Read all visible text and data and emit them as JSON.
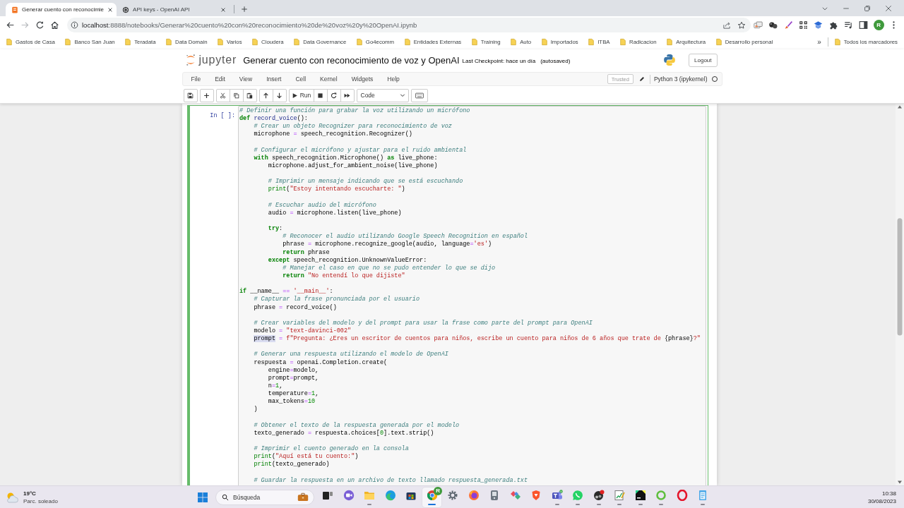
{
  "browser": {
    "tabs": [
      {
        "title": "Generar cuento con reconocimie",
        "selected": true
      },
      {
        "title": "API keys - OpenAI API",
        "selected": false
      }
    ],
    "nav_buttons": [
      {
        "kind": "back",
        "disabled": false
      },
      {
        "kind": "forward",
        "disabled": true
      },
      {
        "kind": "reload",
        "disabled": false
      },
      {
        "kind": "home",
        "disabled": false
      }
    ],
    "address": {
      "host": "localhost",
      "path": ":8888/notebooks/Generar%20cuento%20con%20reconocimiento%20de%20voz%20y%20OpenAI.ipynb"
    },
    "profile_initial": "R",
    "bookmarks": [
      "Gastos de Casa",
      "Banco San Juan",
      "Teradata",
      "Data Domain",
      "Varios",
      "Cloudera",
      "Data Governance",
      "Go4ecomm",
      "Entidades Externas",
      "Training",
      "Auto",
      "Importados",
      "ITBA",
      "Radicacion",
      "Arquitectura",
      "Desarrollo personal"
    ],
    "bookmarks_more": "»",
    "all_bookmarks": "Todos los marcadores"
  },
  "notebook": {
    "logo": "jupyter",
    "title": "Generar cuento con reconocimiento de voz y OpenAI",
    "checkpoint": "Last Checkpoint: hace un día",
    "autosave": "(autosaved)",
    "logout": "Logout",
    "menu": [
      "File",
      "Edit",
      "View",
      "Insert",
      "Cell",
      "Kernel",
      "Widgets",
      "Help"
    ],
    "trusted": "Trusted",
    "kernel": {
      "name": "Python 3 (ipykernel)",
      "busy": false
    },
    "run_label": "Run",
    "cell_type": "Code",
    "cell": {
      "prompt": "In [ ]:",
      "selected": true,
      "code": [
        {
          "kind": "code",
          "tokens": [
            {
              "kind": "comment",
              "text": "# Definir una función para grabar la voz utilizando un micrófono"
            }
          ]
        },
        {
          "kind": "code",
          "tokens": [
            {
              "kind": "keyword",
              "text": "def"
            },
            {
              "kind": "defname",
              "text": " record_voice"
            },
            {
              "kind": "plain",
              "text": "():"
            }
          ],
          "children": [
            {
              "kind": "code",
              "tokens": [
                {
                  "kind": "comment",
                  "text": "# Crear un objeto Recognizer para reconocimiento de voz"
                }
              ]
            },
            {
              "kind": "code",
              "tokens": [
                {
                  "kind": "plain",
                  "text": "microphone "
                },
                {
                  "kind": "operator",
                  "text": "="
                },
                {
                  "kind": "plain",
                  "text": " speech_recognition.Recognizer()"
                }
              ]
            },
            {
              "kind": "blank"
            },
            {
              "kind": "code",
              "tokens": [
                {
                  "kind": "comment",
                  "text": "# Configurar el micrófono y ajustar para el ruido ambiental"
                }
              ]
            },
            {
              "kind": "code",
              "tokens": [
                {
                  "kind": "keyword",
                  "text": "with"
                },
                {
                  "kind": "plain",
                  "text": " speech_recognition.Microphone() "
                },
                {
                  "kind": "keyword",
                  "text": "as"
                },
                {
                  "kind": "plain",
                  "text": " live_phone:"
                }
              ],
              "children": [
                {
                  "kind": "code",
                  "tokens": [
                    {
                      "kind": "plain",
                      "text": "microphone.adjust_for_ambient_noise(live_phone)"
                    }
                  ]
                },
                {
                  "kind": "blank"
                },
                {
                  "kind": "code",
                  "tokens": [
                    {
                      "kind": "comment",
                      "text": "# Imprimir un mensaje indicando que se está escuchando"
                    }
                  ]
                },
                {
                  "kind": "code",
                  "tokens": [
                    {
                      "kind": "builtin",
                      "text": "print"
                    },
                    {
                      "kind": "plain",
                      "text": "("
                    },
                    {
                      "kind": "string",
                      "text": "\"Estoy intentando escucharte: \""
                    },
                    {
                      "kind": "plain",
                      "text": ")"
                    }
                  ]
                },
                {
                  "kind": "blank"
                },
                {
                  "kind": "code",
                  "tokens": [
                    {
                      "kind": "comment",
                      "text": "# Escuchar audio del micrófono"
                    }
                  ]
                },
                {
                  "kind": "code",
                  "tokens": [
                    {
                      "kind": "plain",
                      "text": "audio "
                    },
                    {
                      "kind": "operator",
                      "text": "="
                    },
                    {
                      "kind": "plain",
                      "text": " microphone.listen(live_phone)"
                    }
                  ]
                },
                {
                  "kind": "blank"
                },
                {
                  "kind": "code",
                  "tokens": [
                    {
                      "kind": "keyword",
                      "text": "try"
                    },
                    {
                      "kind": "plain",
                      "text": ":"
                    }
                  ],
                  "children": [
                    {
                      "kind": "code",
                      "tokens": [
                        {
                          "kind": "comment",
                          "text": "# Reconocer el audio utilizando Google Speech Recognition en español"
                        }
                      ]
                    },
                    {
                      "kind": "code",
                      "tokens": [
                        {
                          "kind": "plain",
                          "text": "phrase "
                        },
                        {
                          "kind": "operator",
                          "text": "="
                        },
                        {
                          "kind": "plain",
                          "text": " microphone.recognize_google(audio, language"
                        },
                        {
                          "kind": "operator",
                          "text": "="
                        },
                        {
                          "kind": "string",
                          "text": "'es'"
                        },
                        {
                          "kind": "plain",
                          "text": ")"
                        }
                      ]
                    },
                    {
                      "kind": "code",
                      "tokens": [
                        {
                          "kind": "keyword",
                          "text": "return"
                        },
                        {
                          "kind": "plain",
                          "text": " phrase"
                        }
                      ]
                    }
                  ]
                },
                {
                  "kind": "code",
                  "tokens": [
                    {
                      "kind": "keyword",
                      "text": "except"
                    },
                    {
                      "kind": "plain",
                      "text": " speech_recognition.UnknownValueError:"
                    }
                  ],
                  "children": [
                    {
                      "kind": "code",
                      "tokens": [
                        {
                          "kind": "comment",
                          "text": "# Manejar el caso en que no se pudo entender lo que se dijo"
                        }
                      ]
                    },
                    {
                      "kind": "code",
                      "tokens": [
                        {
                          "kind": "keyword",
                          "text": "return"
                        },
                        {
                          "kind": "string",
                          "text": " \"No entendí lo que dijiste\""
                        }
                      ]
                    }
                  ]
                }
              ]
            }
          ]
        },
        {
          "kind": "blank"
        },
        {
          "kind": "code",
          "tokens": [
            {
              "kind": "keyword",
              "text": "if"
            },
            {
              "kind": "plain",
              "text": " __name__ "
            },
            {
              "kind": "operator",
              "text": "=="
            },
            {
              "kind": "string",
              "text": " '__main__'"
            },
            {
              "kind": "plain",
              "text": ":"
            }
          ],
          "children": [
            {
              "kind": "code",
              "tokens": [
                {
                  "kind": "comment",
                  "text": "# Capturar la frase pronunciada por el usuario"
                }
              ]
            },
            {
              "kind": "code",
              "tokens": [
                {
                  "kind": "plain",
                  "text": "phrase "
                },
                {
                  "kind": "operator",
                  "text": "="
                },
                {
                  "kind": "plain",
                  "text": " record_voice()"
                }
              ]
            },
            {
              "kind": "blank"
            },
            {
              "kind": "code",
              "tokens": [
                {
                  "kind": "comment",
                  "text": "# Crear variables del modelo y del prompt para usar la frase como parte del prompt para OpenAI"
                }
              ]
            },
            {
              "kind": "code",
              "tokens": [
                {
                  "kind": "plain",
                  "text": "modelo "
                },
                {
                  "kind": "operator",
                  "text": "="
                },
                {
                  "kind": "string",
                  "text": " \"text-davinci-002\""
                }
              ]
            },
            {
              "kind": "code",
              "tokens": [
                {
                  "kind": "match",
                  "text": "prompt"
                },
                {
                  "kind": "operator",
                  "text": " ="
                },
                {
                  "kind": "string",
                  "text": " f\"Pregunta: ¿Eres un escritor de cuentos para niños, escribe un cuento para niños de 6 años que trate de "
                },
                {
                  "kind": "plain",
                  "text": "{phrase}"
                },
                {
                  "kind": "string",
                  "text": "?\""
                }
              ]
            },
            {
              "kind": "blank"
            },
            {
              "kind": "code",
              "tokens": [
                {
                  "kind": "comment",
                  "text": "# Generar una respuesta utilizando el modelo de OpenAI"
                }
              ]
            },
            {
              "kind": "code",
              "tokens": [
                {
                  "kind": "plain",
                  "text": "respuesta "
                },
                {
                  "kind": "operator",
                  "text": "="
                },
                {
                  "kind": "plain",
                  "text": " openai.Completion.create("
                }
              ],
              "children": [
                {
                  "kind": "code",
                  "tokens": [
                    {
                      "kind": "plain",
                      "text": "engine"
                    },
                    {
                      "kind": "operator",
                      "text": "="
                    },
                    {
                      "kind": "plain",
                      "text": "modelo,"
                    }
                  ]
                },
                {
                  "kind": "code",
                  "tokens": [
                    {
                      "kind": "plain",
                      "text": "prompt"
                    },
                    {
                      "kind": "operator",
                      "text": "="
                    },
                    {
                      "kind": "plain",
                      "text": "prompt,"
                    }
                  ]
                },
                {
                  "kind": "code",
                  "tokens": [
                    {
                      "kind": "plain",
                      "text": "n"
                    },
                    {
                      "kind": "operator",
                      "text": "="
                    },
                    {
                      "kind": "number",
                      "text": "1"
                    },
                    {
                      "kind": "plain",
                      "text": ","
                    }
                  ]
                },
                {
                  "kind": "code",
                  "tokens": [
                    {
                      "kind": "plain",
                      "text": "temperature"
                    },
                    {
                      "kind": "operator",
                      "text": "="
                    },
                    {
                      "kind": "number",
                      "text": "1"
                    },
                    {
                      "kind": "plain",
                      "text": ","
                    }
                  ]
                },
                {
                  "kind": "code",
                  "tokens": [
                    {
                      "kind": "plain",
                      "text": "max_tokens"
                    },
                    {
                      "kind": "operator",
                      "text": "="
                    },
                    {
                      "kind": "number",
                      "text": "10"
                    }
                  ]
                }
              ]
            },
            {
              "kind": "code",
              "tokens": [
                {
                  "kind": "plain",
                  "text": ")"
                }
              ]
            },
            {
              "kind": "blank"
            },
            {
              "kind": "code",
              "tokens": [
                {
                  "kind": "comment",
                  "text": "# Obtener el texto de la respuesta generada por el modelo"
                }
              ]
            },
            {
              "kind": "code",
              "tokens": [
                {
                  "kind": "plain",
                  "text": "texto_generado "
                },
                {
                  "kind": "operator",
                  "text": "="
                },
                {
                  "kind": "plain",
                  "text": " respuesta.choices["
                },
                {
                  "kind": "number",
                  "text": "0"
                },
                {
                  "kind": "plain",
                  "text": "].text.strip()"
                }
              ]
            },
            {
              "kind": "blank"
            },
            {
              "kind": "code",
              "tokens": [
                {
                  "kind": "comment",
                  "text": "# Imprimir el cuento generado en la consola"
                }
              ]
            },
            {
              "kind": "code",
              "tokens": [
                {
                  "kind": "builtin",
                  "text": "print"
                },
                {
                  "kind": "plain",
                  "text": "("
                },
                {
                  "kind": "string",
                  "text": "\"Aquí está tu cuento:\""
                },
                {
                  "kind": "plain",
                  "text": ")"
                }
              ]
            },
            {
              "kind": "code",
              "tokens": [
                {
                  "kind": "builtin",
                  "text": "print"
                },
                {
                  "kind": "plain",
                  "text": "(texto_generado)"
                }
              ]
            },
            {
              "kind": "blank"
            },
            {
              "kind": "code",
              "tokens": [
                {
                  "kind": "comment",
                  "text": "# Guardar la respuesta en un archivo de texto llamado respuesta_generada.txt"
                }
              ]
            }
          ]
        }
      ]
    }
  },
  "taskbar": {
    "weather": {
      "temperature": "19°C",
      "condition": "Parc. soleado"
    },
    "search": {
      "placeholder": "Búsqueda"
    },
    "apps": [
      {
        "running": false,
        "selected": false
      },
      {
        "running": false,
        "selected": false
      },
      {
        "running": true,
        "selected": false
      },
      {
        "running": false,
        "selected": false
      },
      {
        "running": false,
        "selected": false
      },
      {
        "running": true,
        "selected": true,
        "badge": "R"
      },
      {
        "running": false,
        "selected": false
      },
      {
        "running": false,
        "selected": false
      },
      {
        "running": false,
        "selected": false
      },
      {
        "running": false,
        "selected": false
      },
      {
        "running": false,
        "selected": false
      },
      {
        "running": true,
        "selected": false
      },
      {
        "running": true,
        "selected": false
      },
      {
        "running": true,
        "selected": false
      },
      {
        "running": true,
        "selected": false
      },
      {
        "running": true,
        "selected": false
      },
      {
        "running": true,
        "selected": false
      },
      {
        "running": false,
        "selected": false
      },
      {
        "running": true,
        "selected": false
      }
    ],
    "time": "10:38",
    "date": "30/08/2023"
  }
}
